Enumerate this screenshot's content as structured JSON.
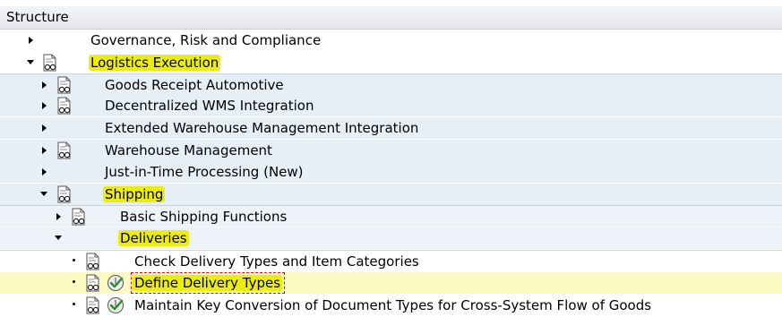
{
  "header": {
    "title": "Structure"
  },
  "rows": [
    {
      "label": "Governance, Risk and Compliance"
    },
    {
      "label": "Logistics Execution"
    },
    {
      "label": "Goods Receipt Automotive"
    },
    {
      "label": "Decentralized WMS Integration"
    },
    {
      "label": "Extended Warehouse Management Integration"
    },
    {
      "label": "Warehouse Management"
    },
    {
      "label": "Just-in-Time Processing (New)"
    },
    {
      "label": "Shipping"
    },
    {
      "label": "Basic Shipping Functions"
    },
    {
      "label": "Deliveries"
    },
    {
      "label": "Check Delivery Types and Item Categories"
    },
    {
      "label": "Define Delivery Types"
    },
    {
      "label": "Maintain Key Conversion of Document Types for Cross-System Flow of Goods"
    }
  ],
  "icons": {
    "docs": "document-glasses-icon",
    "execute": "execute-clock-check-icon",
    "expand": "expand-triangle-icon",
    "collapse": "collapse-triangle-icon",
    "leaf": "leaf-bullet-icon"
  },
  "colors": {
    "highlight": "#ecec12",
    "selected_row": "#fdfbc4",
    "check_green": "#2e8b2e"
  }
}
